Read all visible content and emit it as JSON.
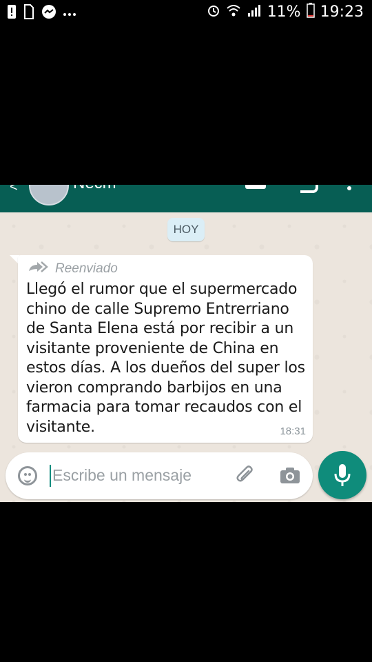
{
  "status_bar": {
    "left_icons": [
      "alert-icon",
      "sim-icon",
      "messenger-icon",
      "more-dots-icon"
    ],
    "battery_percent": "11%",
    "time": "19:23",
    "right_icons": [
      "alarm-icon",
      "wifi-icon",
      "signal-icon",
      "battery-icon"
    ]
  },
  "header": {
    "contact_name": "Necm"
  },
  "chat": {
    "date_chip": "HOY",
    "message": {
      "forwarded_label": "Reenviado",
      "text": "Llegó el rumor que el supermercado chino de calle Supremo Entrerriano de Santa Elena está por recibir a un visitante proveniente de China en estos días. A los dueños del super los vieron comprando barbijos en una farmacia para tomar recaudos con el visitante.",
      "time": "18:31"
    }
  },
  "composer": {
    "placeholder": "Escribe un mensaje"
  },
  "colors": {
    "header": "#075e54",
    "chat_background": "#ece5dd",
    "mic_button": "#0f8c7b"
  }
}
